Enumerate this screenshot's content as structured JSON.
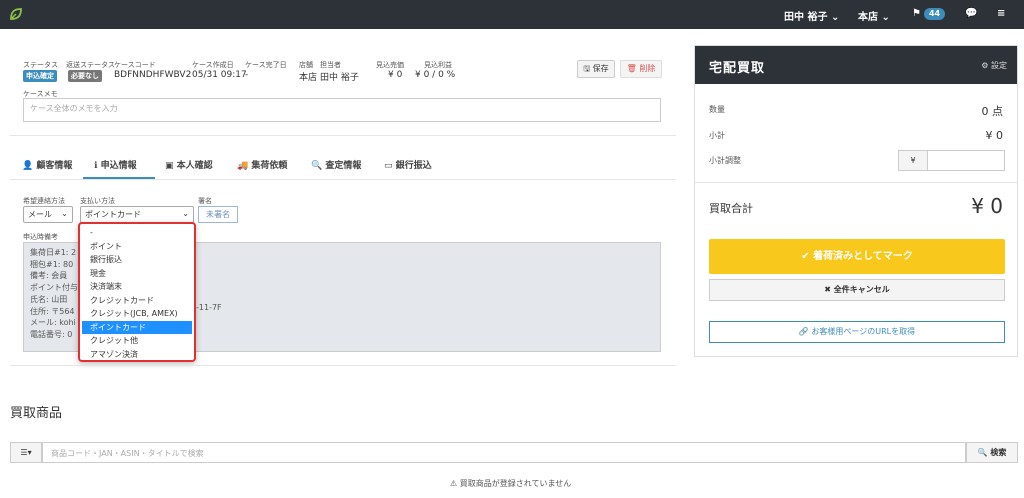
{
  "nav": {
    "user": "田中 裕子 ⌄",
    "store": "本店 ⌄",
    "flag_count": "44"
  },
  "case": {
    "status_label": "ステータス",
    "status_value": "申込確定",
    "return_status_label": "返送ステータス",
    "return_status_value": "必要なし",
    "case_code_label": "ケースコード",
    "case_code_value": "BDFNNDHFWBV2",
    "created_label": "ケース作成日",
    "created_value": "05/31 09:17",
    "completed_label": "ケース完了日",
    "completed_value": "-",
    "store_label": "店舗",
    "store_value": "本店",
    "staff_label": "担当者",
    "staff_value": "田中 裕子",
    "est_amount_label": "見込売価",
    "est_amount_value": "¥ 0",
    "est_profit_label": "見込利益",
    "est_profit_value": "¥ 0 / 0 %",
    "save_label": "保存",
    "delete_label": "削除",
    "memo_label": "ケースメモ",
    "memo_placeholder": "ケース全体のメモを入力",
    "status_color": "#3c8dbc",
    "return_status_color": "#777777"
  },
  "tabs": [
    {
      "label": "顧客情報"
    },
    {
      "label": "申込情報"
    },
    {
      "label": "本人確認"
    },
    {
      "label": "集荷依頼"
    },
    {
      "label": "査定情報"
    },
    {
      "label": "銀行振込"
    }
  ],
  "form": {
    "contact_label": "希望連絡方法",
    "contact_value": "メール",
    "payment_label": "支払い方法",
    "payment_value": "ポイントカード",
    "signature_label": "署名",
    "signature_button": "未署名",
    "remarks_label": "申込時備考",
    "remarks_lines": [
      "集荷日#1: 2",
      "梱包#1: 80",
      "備考: 会員",
      "ポイント付与",
      "氏名: 山田",
      "住所: 〒564",
      "メール: kohi",
      "電話番号: 0"
    ],
    "remarks_extra": "-11-7F"
  },
  "dropdown": {
    "options": [
      "-",
      "ポイント",
      "銀行振込",
      "現金",
      "決済端末",
      "クレジットカード",
      "クレジット(JCB, AMEX)",
      "ポイントカード",
      "クレジット他",
      "アマゾン決済"
    ],
    "selected_index": 7
  },
  "purchase": {
    "section_title": "買取商品",
    "search_placeholder": "商品コード・JAN・ASIN・タイトルで検索",
    "search_button": "検索",
    "empty_message": "買取商品が登録されていません"
  },
  "panel": {
    "title": "宅配買取",
    "settings_label": "設定",
    "qty_label": "数量",
    "qty_value": "0 点",
    "subtotal_label": "小計",
    "subtotal_value": "¥ 0",
    "adjust_label": "小計調整",
    "yen_symbol": "¥",
    "total_label": "買取合計",
    "total_value": "¥ 0",
    "mark_arrived_label": "着荷済みとしてマーク",
    "cancel_all_label": "全件キャンセル",
    "customer_url_label": "お客様用ページのURLを取得",
    "accent_color": "#f8c91c"
  }
}
